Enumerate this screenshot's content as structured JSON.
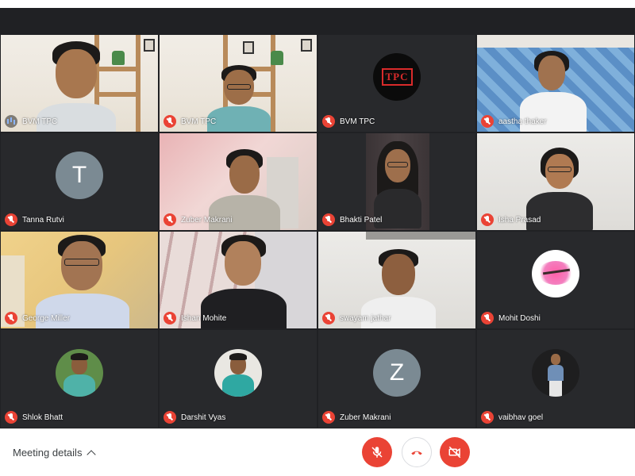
{
  "participants": [
    {
      "name": "BVM TPC",
      "mic": "on"
    },
    {
      "name": "BVM TPC",
      "mic": "off"
    },
    {
      "name": "BVM TPC",
      "mic": "off",
      "avatar_text": "TPC"
    },
    {
      "name": "aastha thaker",
      "mic": "off"
    },
    {
      "name": "Tanna Rutvi",
      "mic": "off",
      "avatar_letter": "T"
    },
    {
      "name": "Zuber Makrani",
      "mic": "off"
    },
    {
      "name": "Bhakti Patel",
      "mic": "off"
    },
    {
      "name": "Isha Prasad",
      "mic": "off"
    },
    {
      "name": "George Miller",
      "mic": "off"
    },
    {
      "name": "Ishan Mohite",
      "mic": "off"
    },
    {
      "name": "swayam jathar",
      "mic": "off"
    },
    {
      "name": "Mohit Doshi",
      "mic": "off"
    },
    {
      "name": "Shlok Bhatt",
      "mic": "off"
    },
    {
      "name": "Darshit Vyas",
      "mic": "off"
    },
    {
      "name": "Zuber Makrani",
      "mic": "off",
      "avatar_letter": "Z"
    },
    {
      "name": "vaibhav goel",
      "mic": "off"
    }
  ],
  "controls": {
    "meeting_details_label": "Meeting details",
    "mic_state": "muted",
    "camera_state": "off"
  },
  "colors": {
    "stage_bg": "#202124",
    "tile_bg": "#3c4043",
    "muted_red": "#ea4335",
    "speaking_blue": "#8ab4f8"
  },
  "icons": [
    "mic-off-icon",
    "mic-on-icon",
    "hang-up-icon",
    "camera-off-icon",
    "chevron-up-icon"
  ]
}
